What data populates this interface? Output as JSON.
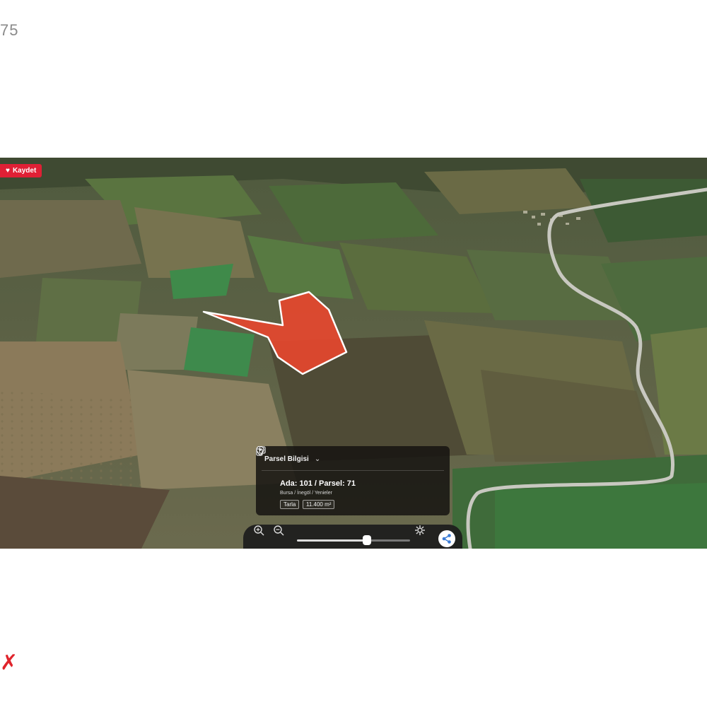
{
  "page": {
    "corner_number": "75",
    "corner_mark": "✗"
  },
  "map": {
    "saved_badge": "Kaydet",
    "parcel_color": "#e8472e"
  },
  "parcel_card": {
    "title": "Parsel Bilgisi",
    "chevron": "⌄",
    "parcel_id": "Ada: 101 / Parsel: 71",
    "location": "Bursa / İnegöl / Yenieler",
    "type_chip": "Tarla",
    "area_chip": "11.400 m²",
    "icons": [
      "copy-icon",
      "location-pin-icon"
    ]
  },
  "toolbar": {
    "slider_value": 0.62,
    "icons": [
      "zoom-in-icon",
      "zoom-out-icon",
      "settings-icon",
      "share-icon"
    ]
  }
}
